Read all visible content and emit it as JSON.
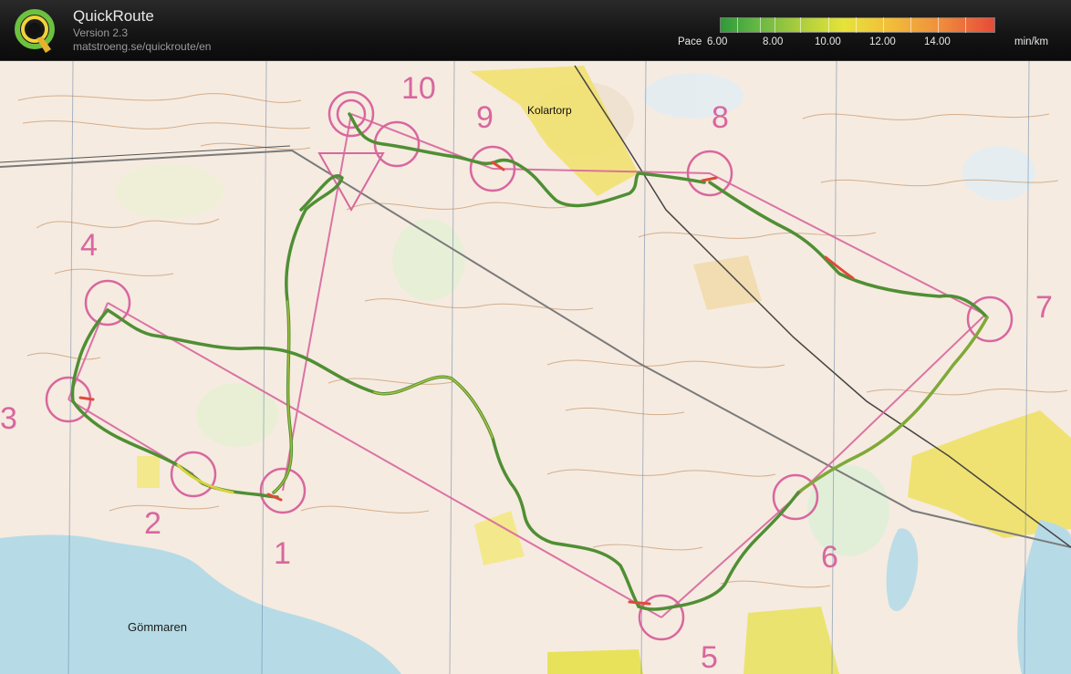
{
  "app": {
    "title": "QuickRoute",
    "version": "Version 2.3",
    "url": "matstroeng.se/quickroute/en",
    "logo_icon": "quickroute-q-logo"
  },
  "pace_legend": {
    "label": "Pace",
    "ticks": [
      "6.00",
      "8.00",
      "10.00",
      "12.00",
      "14.00"
    ],
    "unit": "min/km",
    "colors": [
      "#2e9a38",
      "#a8cc3c",
      "#e6e33a",
      "#f2bd3a",
      "#e84a3a"
    ]
  },
  "map": {
    "lake_name": "Gömmaren",
    "place_name": "Kolartorp",
    "controls": [
      "1",
      "2",
      "3",
      "4",
      "5",
      "6",
      "7",
      "8",
      "9",
      "10"
    ],
    "course_color": "#d8679f",
    "route_color": "#5e8f3a"
  }
}
